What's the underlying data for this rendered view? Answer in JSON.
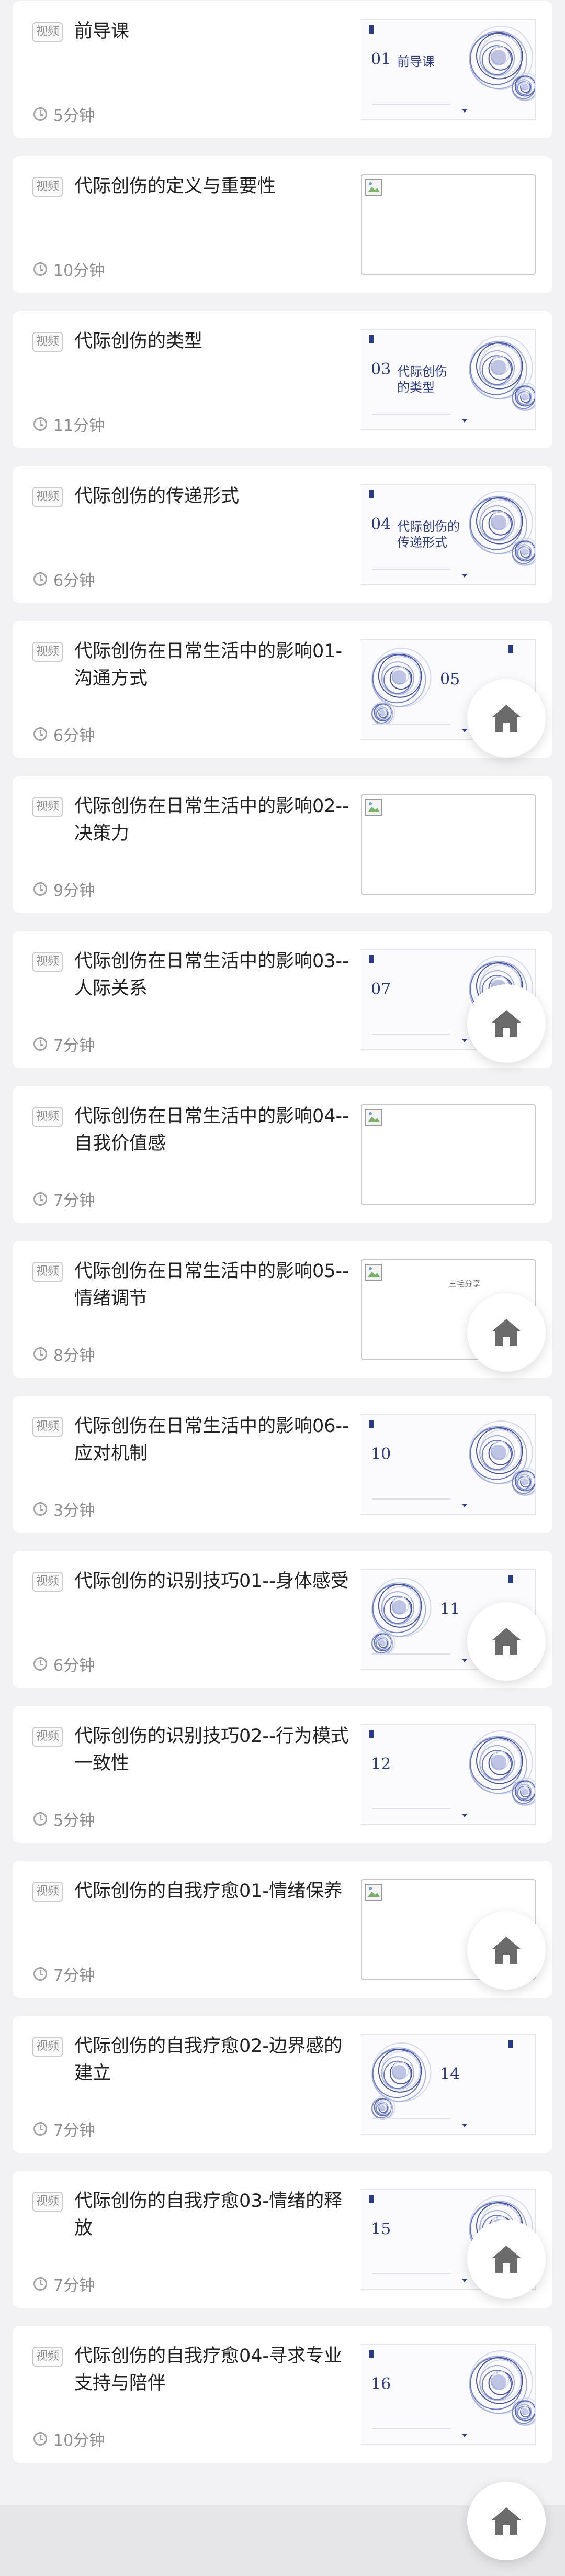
{
  "badge_label": "视频",
  "colors": {
    "accent": "#2a3a8a",
    "text": "#222222",
    "muted": "#8e8e8e",
    "card": "#ffffff",
    "page": "#f2f2f4"
  },
  "lessons": [
    {
      "title": "前导课",
      "duration": "5分钟",
      "thumb_type": "slide",
      "slide_number": "01",
      "slide_title": [
        "前导课"
      ]
    },
    {
      "title": "代际创伤的定义与重要性",
      "duration": "10分钟",
      "thumb_type": "broken"
    },
    {
      "title": "代际创伤的类型",
      "duration": "11分钟",
      "thumb_type": "slide",
      "slide_number": "03",
      "slide_title": [
        "代际创伤",
        "的类型"
      ]
    },
    {
      "title": "代际创伤的传递形式",
      "duration": "6分钟",
      "thumb_type": "slide",
      "slide_number": "04",
      "slide_title": [
        "代际创伤的",
        "传递形式"
      ]
    },
    {
      "title": "代际创伤在日常生活中的影响01-沟通方式",
      "duration": "6分钟",
      "thumb_type": "slide",
      "slide_number": "05",
      "slide_title": []
    },
    {
      "title": "代际创伤在日常生活中的影响02--决策力",
      "duration": "9分钟",
      "thumb_type": "broken"
    },
    {
      "title": "代际创伤在日常生活中的影响03--人际关系",
      "duration": "7分钟",
      "thumb_type": "slide",
      "slide_number": "07",
      "slide_title": []
    },
    {
      "title": "代际创伤在日常生活中的影响04--自我价值感",
      "duration": "7分钟",
      "thumb_type": "broken"
    },
    {
      "title": "代际创伤在日常生活中的影响05--情绪调节",
      "duration": "8分钟",
      "thumb_type": "broken"
    },
    {
      "title": "代际创伤在日常生活中的影响06--应对机制",
      "duration": "3分钟",
      "thumb_type": "slide",
      "slide_number": "10",
      "slide_title": []
    },
    {
      "title": "代际创伤的识别技巧01--身体感受",
      "duration": "6分钟",
      "thumb_type": "slide",
      "slide_number": "11",
      "slide_title": []
    },
    {
      "title": "代际创伤的识别技巧02--行为模式一致性",
      "duration": "5分钟",
      "thumb_type": "slide",
      "slide_number": "12",
      "slide_title": []
    },
    {
      "title": "代际创伤的自我疗愈01-情绪保养",
      "duration": "7分钟",
      "thumb_type": "broken"
    },
    {
      "title": "代际创伤的自我疗愈02-边界感的建立",
      "duration": "7分钟",
      "thumb_type": "slide",
      "slide_number": "14",
      "slide_title": []
    },
    {
      "title": "代际创伤的自我疗愈03-情绪的释放",
      "duration": "7分钟",
      "thumb_type": "slide",
      "slide_number": "15",
      "slide_title": []
    },
    {
      "title": "代际创伤的自我疗愈04-寻求专业支持与陪伴",
      "duration": "10分钟",
      "thumb_type": "slide",
      "slide_number": "16",
      "slide_title": []
    }
  ],
  "watermark": "三毛分享"
}
